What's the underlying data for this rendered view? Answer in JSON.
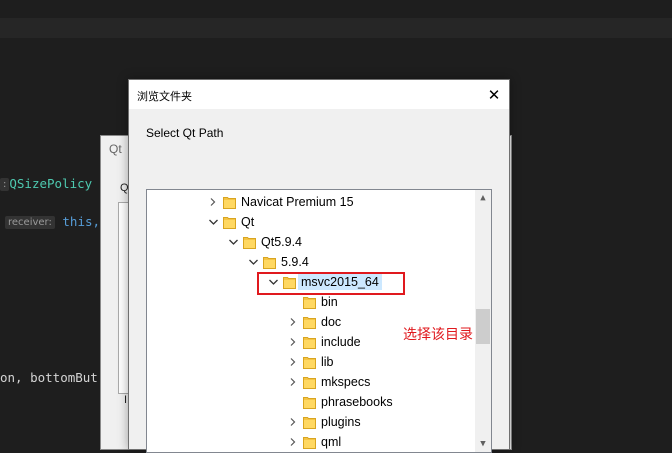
{
  "editor": {
    "line1": {
      "class_name": "QSizePolicy"
    },
    "line2": {
      "hint": "receiver:",
      "arg": "this,"
    },
    "line3": {
      "text": "on, bottomBut"
    }
  },
  "back_dialog": {
    "title": "Qt",
    "q_text": "Q",
    "l_text": "I"
  },
  "dialog": {
    "title": "浏览文件夹",
    "close_label": "✕",
    "description": "Select Qt Path",
    "tree": [
      {
        "label": "Navicat Premium 15",
        "state": "collapsed"
      },
      {
        "label": "Qt",
        "state": "expanded"
      },
      {
        "label": "Qt5.9.4",
        "state": "expanded"
      },
      {
        "label": "5.9.4",
        "state": "expanded"
      },
      {
        "label": "msvc2015_64",
        "state": "expanded",
        "selected": true
      },
      {
        "label": "bin",
        "state": "none"
      },
      {
        "label": "doc",
        "state": "collapsed"
      },
      {
        "label": "include",
        "state": "collapsed"
      },
      {
        "label": "lib",
        "state": "collapsed"
      },
      {
        "label": "mkspecs",
        "state": "collapsed"
      },
      {
        "label": "phrasebooks",
        "state": "none"
      },
      {
        "label": "plugins",
        "state": "collapsed"
      },
      {
        "label": "qml",
        "state": "collapsed"
      }
    ]
  },
  "annotation": {
    "text": "选择该目录"
  },
  "colors": {
    "folder": "#f5c445",
    "selection": "#cce8ff",
    "annotation": "#e0191e"
  }
}
